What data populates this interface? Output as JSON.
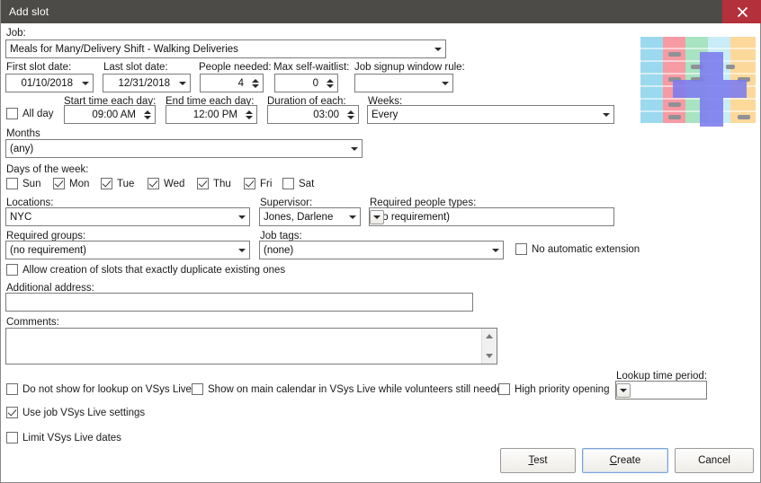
{
  "window": {
    "title": "Add slot",
    "close_icon": "close-icon",
    "titlebar_color": "#4d4b48",
    "close_color": "#b4303a"
  },
  "job": {
    "label": "Job:",
    "value": "Meals for Many/Delivery Shift - Walking Deliveries"
  },
  "dates": {
    "first_label": "First slot date:",
    "first_value": "01/10/2018",
    "last_label": "Last slot date:",
    "last_value": "12/31/2018"
  },
  "people": {
    "needed_label": "People needed:",
    "needed_value": "4",
    "waitlist_label": "Max self-waitlist:",
    "waitlist_value": "0"
  },
  "signup_rule": {
    "label": "Job signup window rule:",
    "value": ""
  },
  "times": {
    "all_day_label": "All day",
    "all_day_checked": false,
    "start_label": "Start time each day:",
    "start_value": "09:00 AM",
    "end_label": "End time each day:",
    "end_value": "12:00 PM",
    "duration_label": "Duration of each:",
    "duration_value": "03:00",
    "weeks_label": "Weeks:",
    "weeks_value": "Every"
  },
  "months": {
    "label": "Months",
    "value": "(any)"
  },
  "days": {
    "label": "Days of the week:",
    "items": [
      {
        "label": "Sun",
        "checked": false
      },
      {
        "label": "Mon",
        "checked": true
      },
      {
        "label": "Tue",
        "checked": true
      },
      {
        "label": "Wed",
        "checked": true
      },
      {
        "label": "Thu",
        "checked": true
      },
      {
        "label": "Fri",
        "checked": true
      },
      {
        "label": "Sat",
        "checked": false
      }
    ]
  },
  "locations": {
    "label": "Locations:",
    "value": "NYC"
  },
  "supervisor": {
    "label": "Supervisor:",
    "value": "Jones, Darlene"
  },
  "people_types": {
    "label": "Required people types:",
    "value": "(no requirement)"
  },
  "required_groups": {
    "label": "Required groups:",
    "value": "(no requirement)"
  },
  "job_tags": {
    "label": "Job tags:",
    "value": "(none)"
  },
  "no_auto_extension": {
    "label": "No automatic extension",
    "checked": false
  },
  "allow_duplicate": {
    "label": "Allow creation of slots that exactly duplicate existing ones",
    "checked": false
  },
  "additional_address": {
    "label": "Additional address:",
    "value": ""
  },
  "comments": {
    "label": "Comments:",
    "value": ""
  },
  "vsys": {
    "do_not_show": {
      "label": "Do not show for lookup on VSys Live",
      "checked": false
    },
    "show_main_calendar": {
      "label": "Show on main calendar in VSys Live while volunteers still needed",
      "checked": false
    },
    "high_priority": {
      "label": "High priority opening",
      "checked": false
    },
    "use_job_settings": {
      "label": "Use job VSys Live settings",
      "checked": true
    },
    "limit_dates": {
      "label": "Limit VSys Live dates",
      "checked": false
    }
  },
  "lookup_period": {
    "label": "Lookup time period:",
    "value": ""
  },
  "buttons": {
    "test": {
      "pre": "",
      "accel": "T",
      "post": "est"
    },
    "create": {
      "pre": "",
      "accel": "C",
      "post": "reate"
    },
    "cancel": {
      "label": "Cancel"
    }
  },
  "logo": {
    "name": "calendar-plus-graphic",
    "columns": [
      "#9ad9ee",
      "#f79aa3",
      "#a8e3c2",
      "#c9ecf7",
      "#fcd99b"
    ],
    "plus_color": "#7b7bee",
    "mark_color": "#8f9196"
  }
}
